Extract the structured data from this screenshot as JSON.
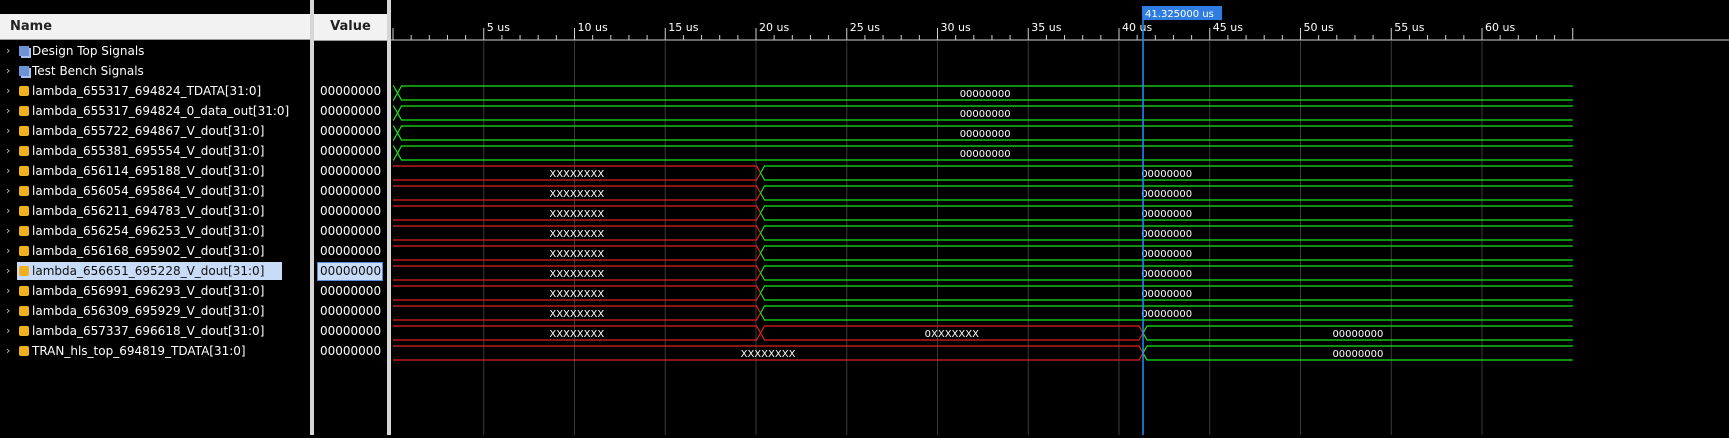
{
  "columns": {
    "name": "Name",
    "value": "Value"
  },
  "cursor": {
    "label": "41.325000 us",
    "time_us": 41.325
  },
  "timeline": {
    "ticks": [
      {
        "t": 5,
        "label": "5 us"
      },
      {
        "t": 10,
        "label": "10 us"
      },
      {
        "t": 15,
        "label": "15 us"
      },
      {
        "t": 20,
        "label": "20 us"
      },
      {
        "t": 25,
        "label": "25 us"
      },
      {
        "t": 30,
        "label": "30 us"
      },
      {
        "t": 35,
        "label": "35 us"
      },
      {
        "t": 40,
        "label": "40 us"
      },
      {
        "t": 45,
        "label": "45 us"
      },
      {
        "t": 50,
        "label": "50 us"
      },
      {
        "t": 55,
        "label": "55 us"
      },
      {
        "t": 60,
        "label": "60 us"
      }
    ]
  },
  "signals": [
    {
      "name": "Design Top Signals",
      "kind": "group"
    },
    {
      "name": "Test Bench Signals",
      "kind": "group"
    },
    {
      "name": "lambda_655317_694824_TDATA[31:0]",
      "kind": "bus",
      "value": "00000000",
      "segments": [
        {
          "start": 0,
          "end": 0.25,
          "label": "",
          "color": "green"
        },
        {
          "start": 0.25,
          "end": 65,
          "label": "00000000",
          "color": "green"
        }
      ]
    },
    {
      "name": "lambda_655317_694824_0_data_out[31:0]",
      "kind": "bus",
      "value": "00000000",
      "segments": [
        {
          "start": 0,
          "end": 0.25,
          "label": "",
          "color": "green"
        },
        {
          "start": 0.25,
          "end": 65,
          "label": "00000000",
          "color": "green"
        }
      ]
    },
    {
      "name": "lambda_655722_694867_V_dout[31:0]",
      "kind": "bus",
      "value": "00000000",
      "segments": [
        {
          "start": 0,
          "end": 0.25,
          "label": "",
          "color": "green"
        },
        {
          "start": 0.25,
          "end": 65,
          "label": "00000000",
          "color": "green"
        }
      ]
    },
    {
      "name": "lambda_655381_695554_V_dout[31:0]",
      "kind": "bus",
      "value": "00000000",
      "segments": [
        {
          "start": 0,
          "end": 0.25,
          "label": "",
          "color": "green"
        },
        {
          "start": 0.25,
          "end": 65,
          "label": "00000000",
          "color": "green"
        }
      ]
    },
    {
      "name": "lambda_656114_695188_V_dout[31:0]",
      "kind": "bus",
      "value": "00000000",
      "segments": [
        {
          "start": 0,
          "end": 20.25,
          "label": "XXXXXXXX",
          "color": "red"
        },
        {
          "start": 20.25,
          "end": 65,
          "label": "00000000",
          "color": "green"
        }
      ]
    },
    {
      "name": "lambda_656054_695864_V_dout[31:0]",
      "kind": "bus",
      "value": "00000000",
      "segments": [
        {
          "start": 0,
          "end": 20.25,
          "label": "XXXXXXXX",
          "color": "red"
        },
        {
          "start": 20.25,
          "end": 65,
          "label": "00000000",
          "color": "green"
        }
      ]
    },
    {
      "name": "lambda_656211_694783_V_dout[31:0]",
      "kind": "bus",
      "value": "00000000",
      "segments": [
        {
          "start": 0,
          "end": 20.25,
          "label": "XXXXXXXX",
          "color": "red"
        },
        {
          "start": 20.25,
          "end": 65,
          "label": "00000000",
          "color": "green"
        }
      ]
    },
    {
      "name": "lambda_656254_696253_V_dout[31:0]",
      "kind": "bus",
      "value": "00000000",
      "segments": [
        {
          "start": 0,
          "end": 20.25,
          "label": "XXXXXXXX",
          "color": "red"
        },
        {
          "start": 20.25,
          "end": 65,
          "label": "00000000",
          "color": "green"
        }
      ]
    },
    {
      "name": "lambda_656168_695902_V_dout[31:0]",
      "kind": "bus",
      "value": "00000000",
      "segments": [
        {
          "start": 0,
          "end": 20.25,
          "label": "XXXXXXXX",
          "color": "red"
        },
        {
          "start": 20.25,
          "end": 65,
          "label": "00000000",
          "color": "green"
        }
      ]
    },
    {
      "name": "lambda_656651_695228_V_dout[31:0]",
      "kind": "bus",
      "value": "00000000",
      "selected": true,
      "segments": [
        {
          "start": 0,
          "end": 20.25,
          "label": "XXXXXXXX",
          "color": "red"
        },
        {
          "start": 20.25,
          "end": 65,
          "label": "00000000",
          "color": "green"
        }
      ]
    },
    {
      "name": "lambda_656991_696293_V_dout[31:0]",
      "kind": "bus",
      "value": "00000000",
      "segments": [
        {
          "start": 0,
          "end": 20.25,
          "label": "XXXXXXXX",
          "color": "red"
        },
        {
          "start": 20.25,
          "end": 65,
          "label": "00000000",
          "color": "green"
        }
      ]
    },
    {
      "name": "lambda_656309_695929_V_dout[31:0]",
      "kind": "bus",
      "value": "00000000",
      "segments": [
        {
          "start": 0,
          "end": 20.25,
          "label": "XXXXXXXX",
          "color": "red"
        },
        {
          "start": 20.25,
          "end": 65,
          "label": "00000000",
          "color": "green"
        }
      ]
    },
    {
      "name": "lambda_657337_696618_V_dout[31:0]",
      "kind": "bus",
      "value": "00000000",
      "segments": [
        {
          "start": 0,
          "end": 20.25,
          "label": "XXXXXXXX",
          "color": "red"
        },
        {
          "start": 20.25,
          "end": 41.325,
          "label": "0XXXXXXX",
          "color": "red"
        },
        {
          "start": 41.325,
          "end": 65,
          "label": "00000000",
          "color": "green"
        }
      ]
    },
    {
      "name": "TRAN_hls_top_694819_TDATA[31:0]",
      "kind": "bus",
      "value": "00000000",
      "segments": [
        {
          "start": 0,
          "end": 41.325,
          "label": "XXXXXXXX",
          "color": "red"
        },
        {
          "start": 41.325,
          "end": 65,
          "label": "00000000",
          "color": "green"
        }
      ]
    }
  ],
  "colors": {
    "green": "#19e619",
    "red": "#e02020",
    "cursor": "#1e90ff",
    "cursor_label_bg": "#2f7de0",
    "grid": "#3a3a3a"
  }
}
